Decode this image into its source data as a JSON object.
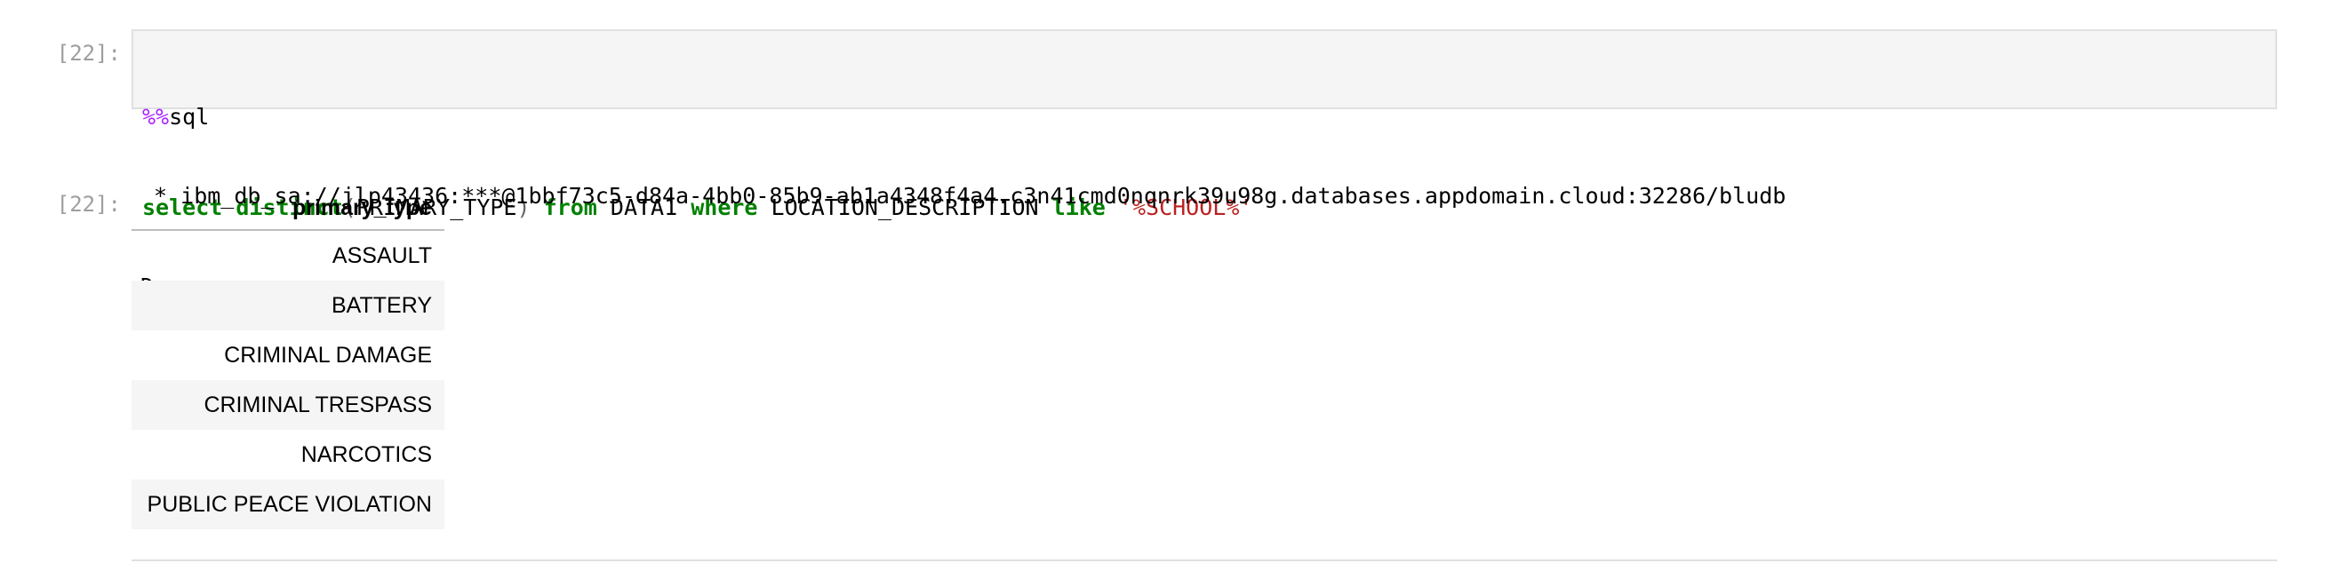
{
  "cell": {
    "input_prompt": "[22]:",
    "output_prompt": "[22]:",
    "code": {
      "line1": {
        "magic": "%%",
        "rest": "sql"
      },
      "line2": {
        "kw_select": "select",
        "kw_distinct": "distinct",
        "paren_open": "(",
        "column": "PRIMARY_TYPE",
        "paren_close": ")",
        "kw_from": "from",
        "table": "DATA1",
        "kw_where": "where",
        "column2": "LOCATION_DESCRIPTION",
        "kw_like": "like",
        "pattern": "'%SCHOOL%'"
      }
    },
    "stream_output": {
      "connection_line": " * ibm_db_sa://jlp43436:***@1bbf73c5-d84a-4bb0-85b9-ab1a4348f4a4.c3n41cmd0nqnrk39u98g.databases.appdomain.cloud:32286/bludb",
      "status_line": "Done."
    },
    "result_table": {
      "header": "primary_type",
      "rows": [
        "ASSAULT",
        "BATTERY",
        "CRIMINAL DAMAGE",
        "CRIMINAL TRESPASS",
        "NARCOTICS",
        "PUBLIC PEACE VIOLATION"
      ]
    }
  }
}
